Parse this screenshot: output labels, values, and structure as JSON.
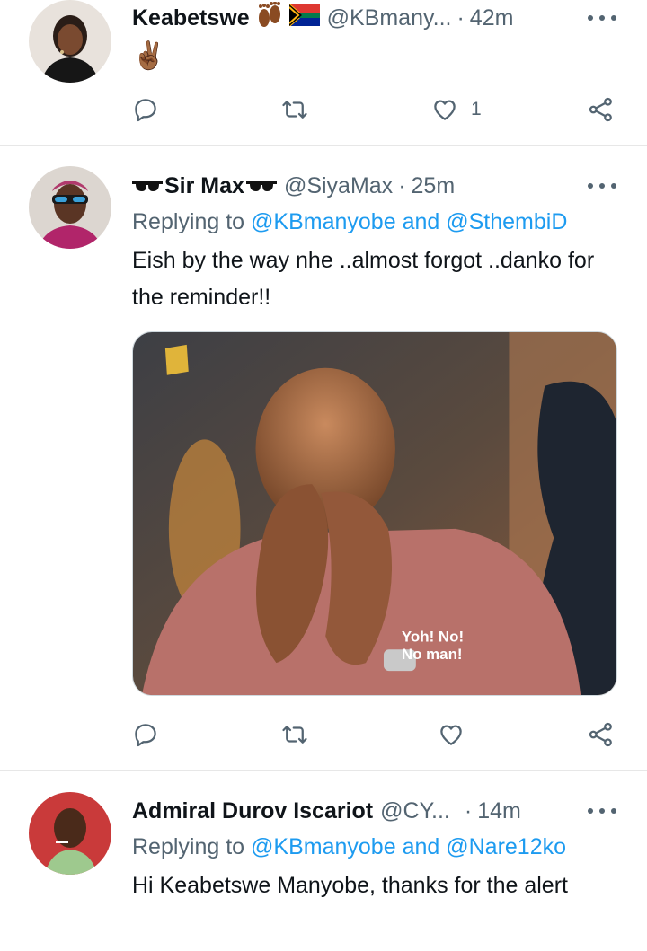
{
  "tweets": [
    {
      "name": "Keabetswe",
      "handle": "@KBmany...",
      "time": "42m",
      "text": "✌🏾",
      "like_count": "1",
      "icons": [
        "footprints-icon",
        "south-africa-flag-icon"
      ]
    },
    {
      "name": "Sir Max",
      "handle": "@SiyaMax",
      "time": "25m",
      "reply_label": "Replying to",
      "mention_1": "@KBmanyobe",
      "and_label": "and",
      "mention_2": "@SthembiD",
      "text": "Eish by the way nhe ..almost forgot ..danko for the reminder!!",
      "media_caption_1": "Yoh! No!",
      "media_caption_2": "No man!"
    },
    {
      "name": "Admiral Durov Iscariot",
      "handle": "@CY...",
      "time": "14m",
      "reply_label": "Replying to",
      "mention_1": "@KBmanyobe",
      "and_label": "and",
      "mention_2": "@Nare12ko",
      "text": "Hi Keabetswe Manyobe,  thanks for the alert"
    }
  ],
  "separator": "·",
  "colors": {
    "text": "#0f1419",
    "secondary": "#536471",
    "link": "#1d9bf0",
    "divider": "#e7e7e7"
  }
}
